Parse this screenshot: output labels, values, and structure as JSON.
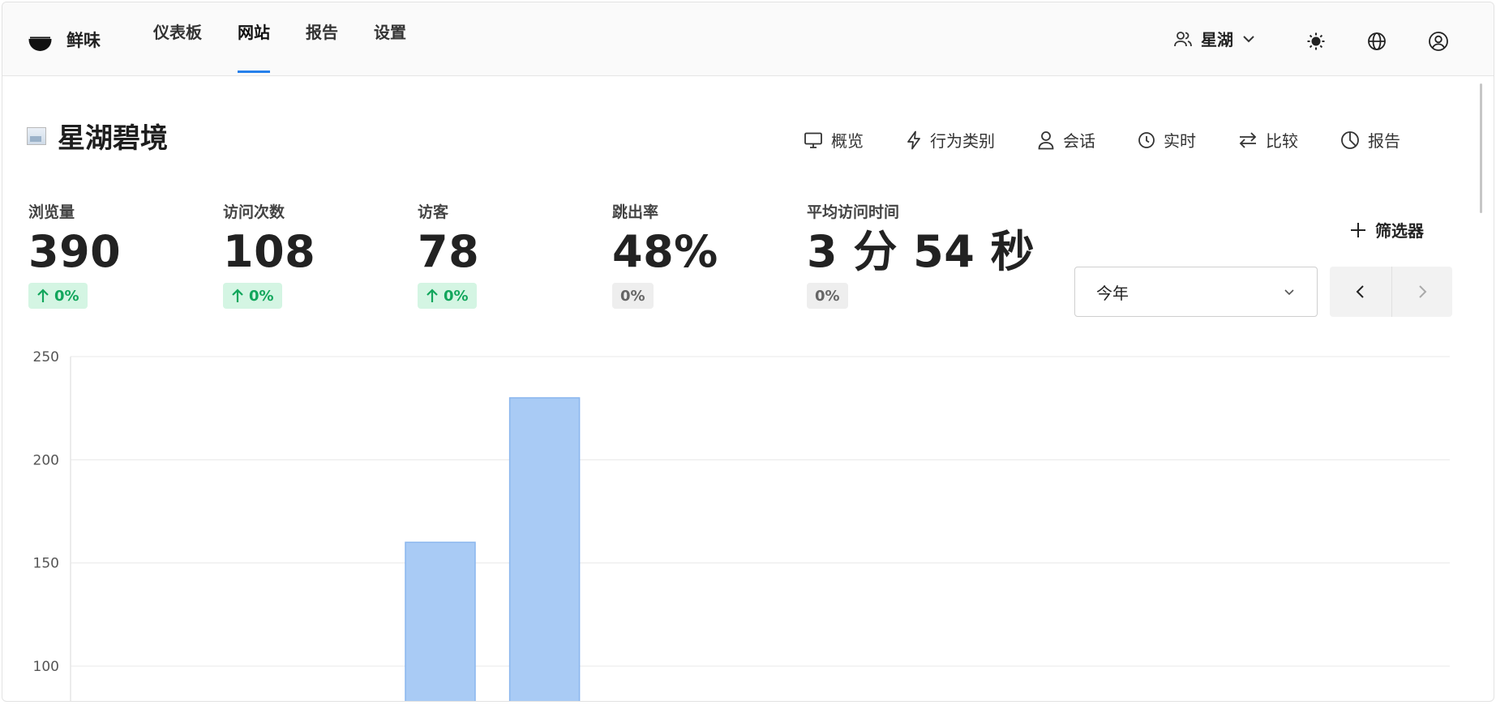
{
  "brand": {
    "name": "鲜味",
    "logo_icon": "bowl-logo-icon"
  },
  "nav": {
    "links": [
      {
        "label": "仪表板",
        "active": false
      },
      {
        "label": "网站",
        "active": true
      },
      {
        "label": "报告",
        "active": false
      },
      {
        "label": "设置",
        "active": false
      }
    ],
    "team_label": "星湖",
    "accent": "#2680eb"
  },
  "site": {
    "title": "星湖碧境",
    "tabs": [
      {
        "label": "概览",
        "icon": "monitor-icon"
      },
      {
        "label": "行为类别",
        "icon": "lightning-icon"
      },
      {
        "label": "会话",
        "icon": "user-icon"
      },
      {
        "label": "实时",
        "icon": "clock-icon"
      },
      {
        "label": "比较",
        "icon": "swap-icon"
      },
      {
        "label": "报告",
        "icon": "pie-icon"
      }
    ]
  },
  "metrics": [
    {
      "label": "浏览量",
      "value": "390",
      "change": "0%",
      "trend": "up"
    },
    {
      "label": "访问次数",
      "value": "108",
      "change": "0%",
      "trend": "up"
    },
    {
      "label": "访客",
      "value": "78",
      "change": "0%",
      "trend": "up"
    },
    {
      "label": "跳出率",
      "value": "48%",
      "change": "0%",
      "trend": "flat"
    },
    {
      "label": "平均访问时间",
      "value": "3 分 54 秒",
      "change": "0%",
      "trend": "flat"
    }
  ],
  "filter": {
    "label": "筛选器"
  },
  "date_range": {
    "selected": "今年"
  },
  "chart_data": {
    "type": "bar",
    "ylim": [
      80,
      250
    ],
    "yticks": [
      100,
      150,
      200,
      250
    ],
    "grid": true,
    "colors": {
      "primary": "#a9cbf5",
      "secondary": "#5b9ff0"
    },
    "bars": [
      {
        "slot": 4,
        "value": 160,
        "overlay": 0
      },
      {
        "slot": 5,
        "value": 230,
        "overlay": 62
      }
    ],
    "slots": 12
  }
}
